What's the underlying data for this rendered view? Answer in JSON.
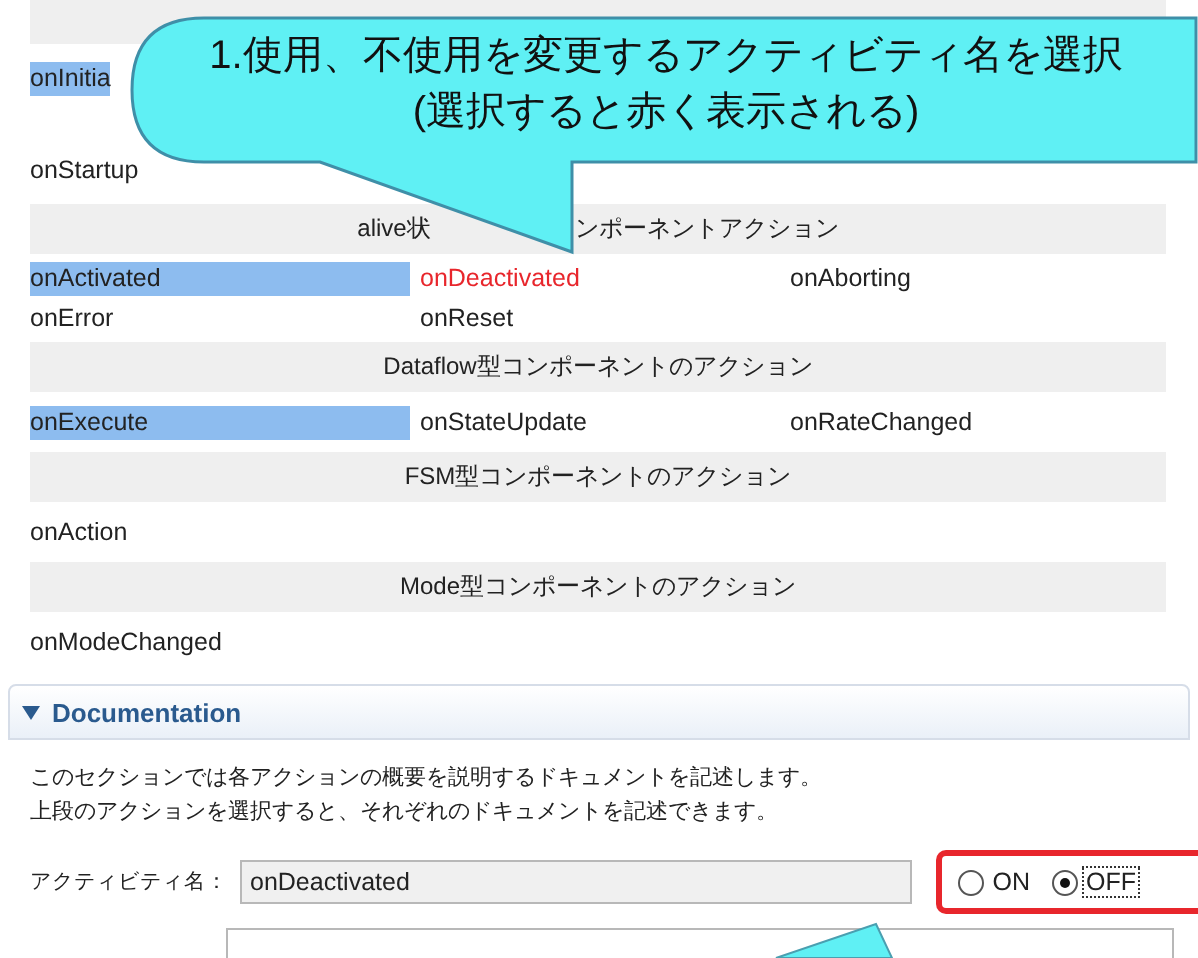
{
  "callout": {
    "lines": [
      "1.使用、不使用を変更するアクティビティ名を選択",
      "(選択すると赤く表示される)"
    ]
  },
  "action_groups": [
    {
      "rows": [
        [
          {
            "label": "onInitia",
            "highlighted": true,
            "selected": false
          }
        ],
        [
          {
            "label": "onStartup",
            "highlighted": false,
            "selected": false
          }
        ]
      ]
    },
    {
      "header_parts": [
        "alive状",
        "ンポーネントアクション"
      ],
      "rows": [
        [
          {
            "label": "onActivated",
            "highlighted": true,
            "selected": false
          },
          {
            "label": "onDeactivated",
            "highlighted": false,
            "selected": true
          },
          {
            "label": "onAborting",
            "highlighted": false,
            "selected": false
          }
        ],
        [
          {
            "label": "onError",
            "highlighted": false,
            "selected": false
          },
          {
            "label": "onReset",
            "highlighted": false,
            "selected": false
          }
        ]
      ]
    },
    {
      "header_parts": [
        "Dataflow型コンポーネントのアクション"
      ],
      "rows": [
        [
          {
            "label": "onExecute",
            "highlighted": true,
            "selected": false
          },
          {
            "label": "onStateUpdate",
            "highlighted": false,
            "selected": false
          },
          {
            "label": "onRateChanged",
            "highlighted": false,
            "selected": false
          }
        ]
      ]
    },
    {
      "header_parts": [
        "FSM型コンポーネントのアクション"
      ],
      "rows": [
        [
          {
            "label": "onAction",
            "highlighted": false,
            "selected": false
          }
        ]
      ]
    },
    {
      "header_parts": [
        "Mode型コンポーネントのアクション"
      ],
      "rows": [
        [
          {
            "label": "onModeChanged",
            "highlighted": false,
            "selected": false
          }
        ]
      ]
    }
  ],
  "documentation": {
    "title": "Documentation",
    "expanded": true,
    "description": [
      "このセクションでは各アクションの概要を説明するドキュメントを記述します。",
      "上段のアクションを選択すると、それぞれのドキュメントを記述できます。"
    ],
    "activity_label": "アクティビティ名：",
    "activity_value": "onDeactivated",
    "options": [
      {
        "label": "ON",
        "selected": false
      },
      {
        "label": "OFF",
        "selected": true
      }
    ]
  }
}
